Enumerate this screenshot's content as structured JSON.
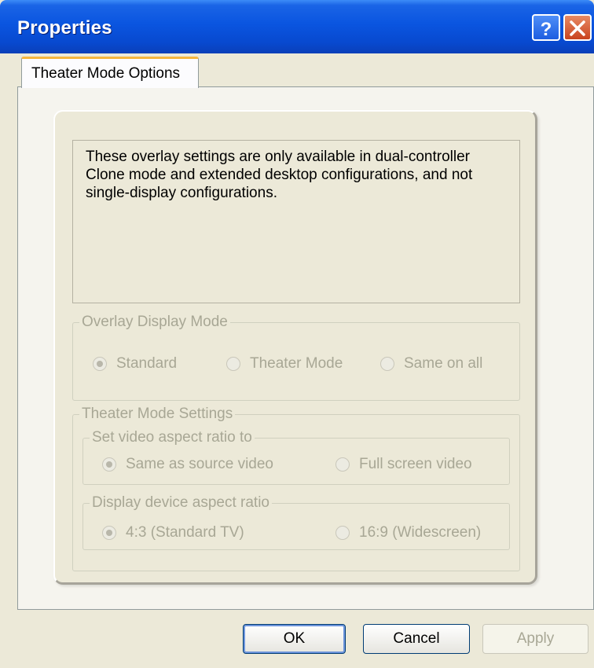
{
  "window": {
    "title": "Properties",
    "help_icon": "help-question-icon",
    "close_icon": "close-x-icon"
  },
  "tabs": [
    {
      "label": "Theater Mode Options",
      "selected": true
    }
  ],
  "info_text": "These overlay settings are only available in dual-controller Clone mode and extended desktop configurations, and not single-display configurations.",
  "overlay_group": {
    "legend": "Overlay Display Mode",
    "options": [
      {
        "label": "Standard",
        "checked": true
      },
      {
        "label": "Theater Mode",
        "checked": false
      },
      {
        "label": "Same on all",
        "checked": false
      }
    ]
  },
  "theater_group": {
    "legend": "Theater Mode Settings",
    "aspect_group": {
      "legend": "Set video aspect ratio to",
      "options": [
        {
          "label": "Same as source video",
          "checked": true
        },
        {
          "label": "Full screen video",
          "checked": false
        }
      ]
    },
    "device_group": {
      "legend": "Display device aspect ratio",
      "options": [
        {
          "label": "4:3 (Standard TV)",
          "checked": true
        },
        {
          "label": "16:9 (Widescreen)",
          "checked": false
        }
      ]
    }
  },
  "buttons": {
    "ok": "OK",
    "cancel": "Cancel",
    "apply": "Apply"
  },
  "colors": {
    "titlebar": "#0a55e0",
    "tab_accent": "#f5b63f",
    "disabled_text": "#a8a795",
    "face": "#ece9d8"
  }
}
